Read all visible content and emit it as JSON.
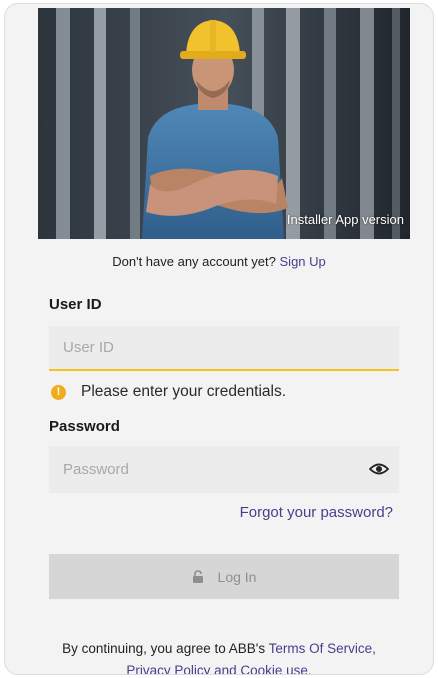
{
  "hero": {
    "version_text": "Installer App version"
  },
  "signup": {
    "prompt": "Don't have any account yet?",
    "link": "Sign Up"
  },
  "user_id": {
    "label": "User ID",
    "placeholder": "User ID",
    "value": ""
  },
  "error": {
    "icon": "warning-icon",
    "message": "Please enter your credentials."
  },
  "password": {
    "label": "Password",
    "placeholder": "Password",
    "value": "",
    "toggle_icon": "eye-icon"
  },
  "forgot_password": "Forgot your password?",
  "login": {
    "label": "Log In",
    "icon": "lock-icon"
  },
  "terms": {
    "prefix": "By continuing, you agree to ABB's",
    "terms_link": "Terms Of Service,",
    "privacy_link": "Privacy Policy and Cookie use."
  },
  "colors": {
    "accent_link": "#4d3c8e",
    "focus_underline": "#f0c419",
    "warning": "#f0ad1b",
    "button_disabled": "#d6d6d6"
  }
}
